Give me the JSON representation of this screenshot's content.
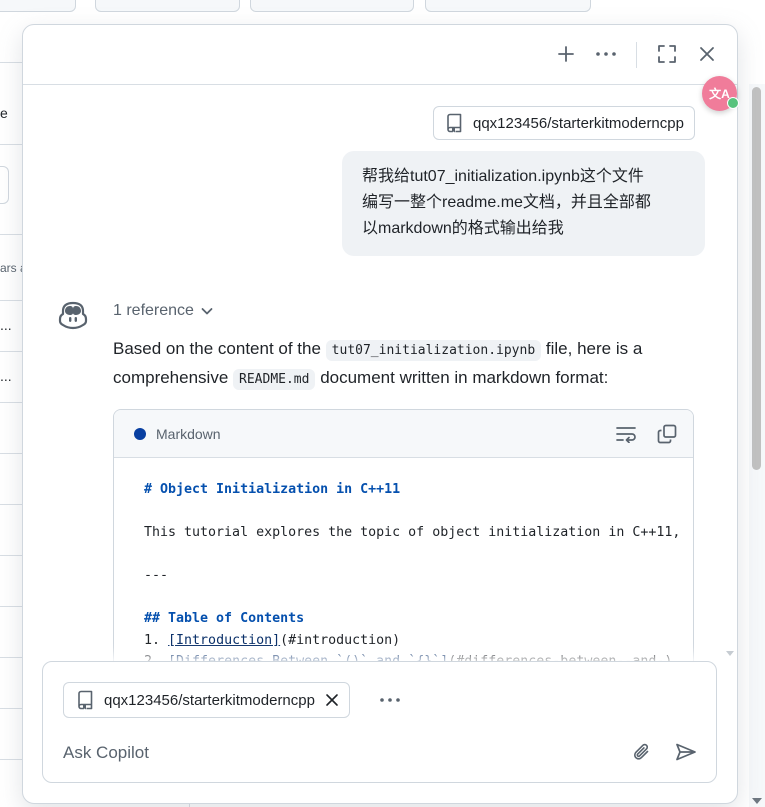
{
  "background": {
    "left_fragments": [
      "e",
      "ars a",
      "...",
      "..."
    ]
  },
  "header": {
    "new_chat_label": "+",
    "more_label": "···",
    "expand_label": "Expand",
    "close_label": "Close"
  },
  "repo_chip": {
    "label": "qqx123456/starterkitmoderncpp"
  },
  "user_message": {
    "line1": "帮我给tut07_initialization.ipynb这个文件",
    "line2": "编写一整个readme.me文档，并且全部都",
    "line3": "以markdown的格式输出给我"
  },
  "assistant": {
    "references_label": "1 reference",
    "intro_part1": "Based on the content of the ",
    "file_code": "tut07_initialization.ipynb",
    "intro_part2": " file, here is a comprehensive ",
    "readme_code": "README.md",
    "intro_part3": " document written in markdown format:",
    "code_block": {
      "language": "Markdown",
      "lines": {
        "heading": "# Object Initialization in C++11",
        "desc": "This tutorial explores the topic of object initialization in C++11,",
        "rule": "---",
        "toc_heading": "## Table of Contents",
        "toc1_num": "1. ",
        "toc1_link": "[Introduction]",
        "toc1_anchor": "(#introduction)",
        "toc2_num": "2. ",
        "toc2_link": "[Differences Between `()` and `{}`]",
        "toc2_anchor": "(#differences-between--and-)"
      }
    }
  },
  "composer": {
    "context_chip": "qqx123456/starterkitmoderncpp",
    "placeholder": "Ask Copilot"
  },
  "colors": {
    "accent_dot": "#083fa1",
    "bubble_bg": "#eff2f5",
    "translate_badge": "#f07c9a"
  },
  "translate_badge": {
    "glyph": "文A"
  }
}
